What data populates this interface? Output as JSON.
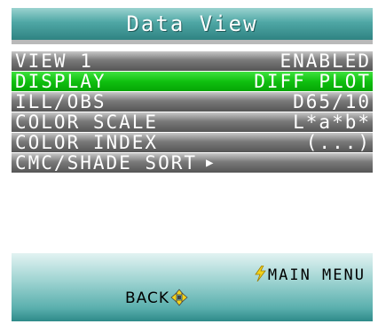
{
  "header": {
    "title": "Data View"
  },
  "menu": {
    "items": [
      {
        "label": "VIEW 1",
        "value": "ENABLED",
        "selected": false
      },
      {
        "label": "DISPLAY",
        "value": "DIFF PLOT",
        "selected": true
      },
      {
        "label": "ILL/OBS",
        "value": "D65/10",
        "selected": false
      },
      {
        "label": "COLOR SCALE",
        "value": "L*a*b*",
        "selected": false
      },
      {
        "label": "COLOR INDEX",
        "value": "(...)",
        "selected": false
      },
      {
        "label": "CMC/SHADE SORT",
        "value": "",
        "selected": false,
        "arrow": "▶"
      }
    ]
  },
  "footer": {
    "main_menu_label": "MAIN MENU",
    "back_label": "BACK"
  },
  "icons": {
    "main_menu": "lightning-bolt-icon",
    "back": "dpad-icon",
    "submenu": "right-arrow-icon"
  },
  "colors": {
    "selected_row": "#10c010",
    "row": "#7a7a7a",
    "title_bar": "#4fa7a5",
    "bolt": "#f2d21b"
  }
}
